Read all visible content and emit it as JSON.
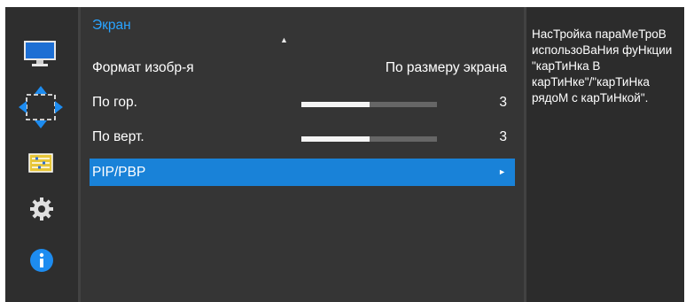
{
  "sidebar": {
    "items": [
      {
        "icon": "monitor-icon"
      },
      {
        "icon": "resize-arrows-icon",
        "selected": true
      },
      {
        "icon": "settings-list-icon"
      },
      {
        "icon": "gear-icon"
      },
      {
        "icon": "info-icon"
      }
    ]
  },
  "menu": {
    "title": "Экран",
    "scroll_up_glyph": "▲",
    "rows": [
      {
        "label": "Формат изобр-я",
        "value": "По размеру экрана"
      },
      {
        "label": "По гор.",
        "value": "3",
        "level": 0.5
      },
      {
        "label": "По верт.",
        "value": "3",
        "level": 0.5
      },
      {
        "label": "PIP/PBP",
        "selected": true,
        "arrow": "►"
      }
    ]
  },
  "description": {
    "text": "НасТройка параМеТроВ использоВаНия фуНкции \"карТиНка В карТиНке\"/\"карТиНка рядоМ с карТиНкой\"."
  },
  "colors": {
    "accent": "#1982d8",
    "title": "#29a3ff",
    "panel": "#353535",
    "background": "#2c2c2c"
  }
}
